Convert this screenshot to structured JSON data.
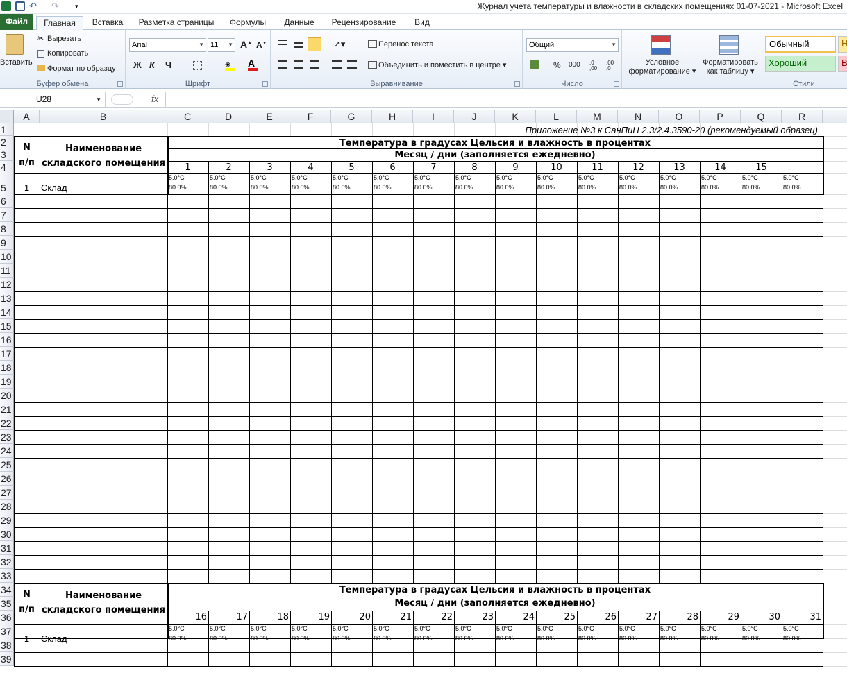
{
  "window": {
    "title": "Журнал учета температуры и влажности в складских помещениях 01-07-2021  -  Microsoft Excel"
  },
  "tabs": [
    "Файл",
    "Главная",
    "Вставка",
    "Разметка страницы",
    "Формулы",
    "Данные",
    "Рецензирование",
    "Вид"
  ],
  "clipboard": {
    "paste": "Вставить",
    "cut": "Вырезать",
    "copy": "Копировать",
    "format_painter": "Формат по образцу",
    "label": "Буфер обмена"
  },
  "font": {
    "name": "Arial",
    "size": "11",
    "bold": "Ж",
    "italic": "К",
    "underline": "Ч",
    "label": "Шрифт"
  },
  "alignment": {
    "wrap": "Перенос текста",
    "merge": "Объединить и поместить в центре",
    "label": "Выравнивание"
  },
  "number": {
    "format": "Общий",
    "percent": "%",
    "thousands": "000",
    "inc": ",0 ,00",
    "dec": ",00 ,0",
    "label": "Число"
  },
  "styles": {
    "conditional_1": "Условное",
    "conditional_2": "форматирование",
    "table_1": "Форматировать",
    "table_2": "как таблицу",
    "normal": "Обычный",
    "good": "Хороший",
    "neutral": "Н",
    "bad": "В",
    "label": "Стили"
  },
  "formula_bar": {
    "name_box": "U28",
    "fx": "fx",
    "value": ""
  },
  "columns": [
    "A",
    "B",
    "C",
    "D",
    "E",
    "F",
    "G",
    "H",
    "I",
    "J",
    "K",
    "L",
    "M",
    "N",
    "O",
    "P",
    "Q",
    "R"
  ],
  "rows": [
    "1",
    "2",
    "3",
    "4",
    "5",
    "6",
    "7",
    "8",
    "9",
    "10",
    "11",
    "12",
    "13",
    "14",
    "15",
    "16",
    "17",
    "18",
    "19",
    "20",
    "21",
    "22",
    "23",
    "24",
    "25",
    "26",
    "27",
    "28",
    "29",
    "30",
    "31",
    "32",
    "33",
    "34",
    "35",
    "36",
    "37",
    "38",
    "39"
  ],
  "sheet": {
    "appendix": "Приложение №3 к СанПиН 2.3/2.4.3590-20 (рекомендуемый образец)",
    "hdr_n_1": "N",
    "hdr_n_2": "п/п",
    "hdr_name_1": "Наименование",
    "hdr_name_2": "складского помещения",
    "hdr_temp": "Температура в градусах Цельсия и влажность в процентах",
    "hdr_month": "Месяц / дни (заполняется ежедневно)",
    "days_1": [
      "1",
      "2",
      "3",
      "4",
      "5",
      "6",
      "7",
      "8",
      "9",
      "10",
      "11",
      "12",
      "13",
      "14",
      "15",
      ""
    ],
    "days_2": [
      "16",
      "17",
      "18",
      "19",
      "20",
      "21",
      "22",
      "23",
      "24",
      "25",
      "26",
      "27",
      "28",
      "29",
      "30",
      "31"
    ],
    "row_num": "1",
    "row_name": "Склад",
    "temp": "5.0°C",
    "hum": "80.0%"
  }
}
